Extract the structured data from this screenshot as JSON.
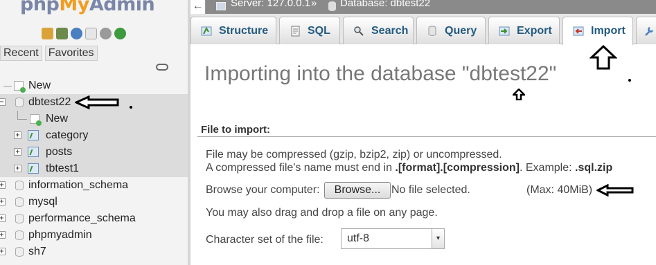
{
  "navigation": {
    "logo": {
      "php": "php",
      "my": "My",
      "admin": "Admin"
    },
    "quick_icons": [
      "home-icon",
      "exit-icon",
      "help-icon",
      "docs-icon",
      "settings-icon",
      "reload-icon"
    ],
    "tabs": [
      "Recent",
      "Favorites"
    ],
    "tree": {
      "new": "New",
      "databases": [
        {
          "name": "dbtest22",
          "selected": true,
          "children": {
            "new": "New",
            "tables": [
              "category",
              "posts",
              "tbtest1"
            ]
          }
        },
        {
          "name": "information_schema"
        },
        {
          "name": "mysql"
        },
        {
          "name": "performance_schema"
        },
        {
          "name": "phpmyadmin"
        },
        {
          "name": "sh7"
        }
      ]
    }
  },
  "breadcrumb": {
    "server": "Server: 127.0.0.1",
    "separator": "»",
    "database": "Database: dbtest22"
  },
  "tabs": [
    {
      "label": "Structure",
      "icon": "structure-icon"
    },
    {
      "label": "SQL",
      "icon": "sql-icon"
    },
    {
      "label": "Search",
      "icon": "search-icon"
    },
    {
      "label": "Query",
      "icon": "query-icon"
    },
    {
      "label": "Export",
      "icon": "export-icon"
    },
    {
      "label": "Import",
      "icon": "import-icon",
      "active": true
    }
  ],
  "main": {
    "title": "Importing into the database \"dbtest22\"",
    "section_heading": "File to import:",
    "compression_note": "File may be compressed (gzip, bzip2, zip) or uncompressed.",
    "filename_note_prefix": "A compressed file's name must end in ",
    "filename_note_format": ".[format].[compression]",
    "filename_note_example_label": ". Example: ",
    "filename_note_example": ".sql.zip",
    "browse_label": "Browse your computer:",
    "browse_button": "Browse...",
    "no_file": "No file selected.",
    "max_size": "(Max: 40MiB)",
    "drag_drop": "You may also drag and drop a file on any page.",
    "charset_label": "Character set of the file:",
    "charset_value": "utf-8"
  },
  "colors": {
    "tab_text": "#235a81",
    "nav_bg": "#f3f3f3",
    "topbar_bg": "#8a8a8a",
    "title_text": "#777777"
  }
}
